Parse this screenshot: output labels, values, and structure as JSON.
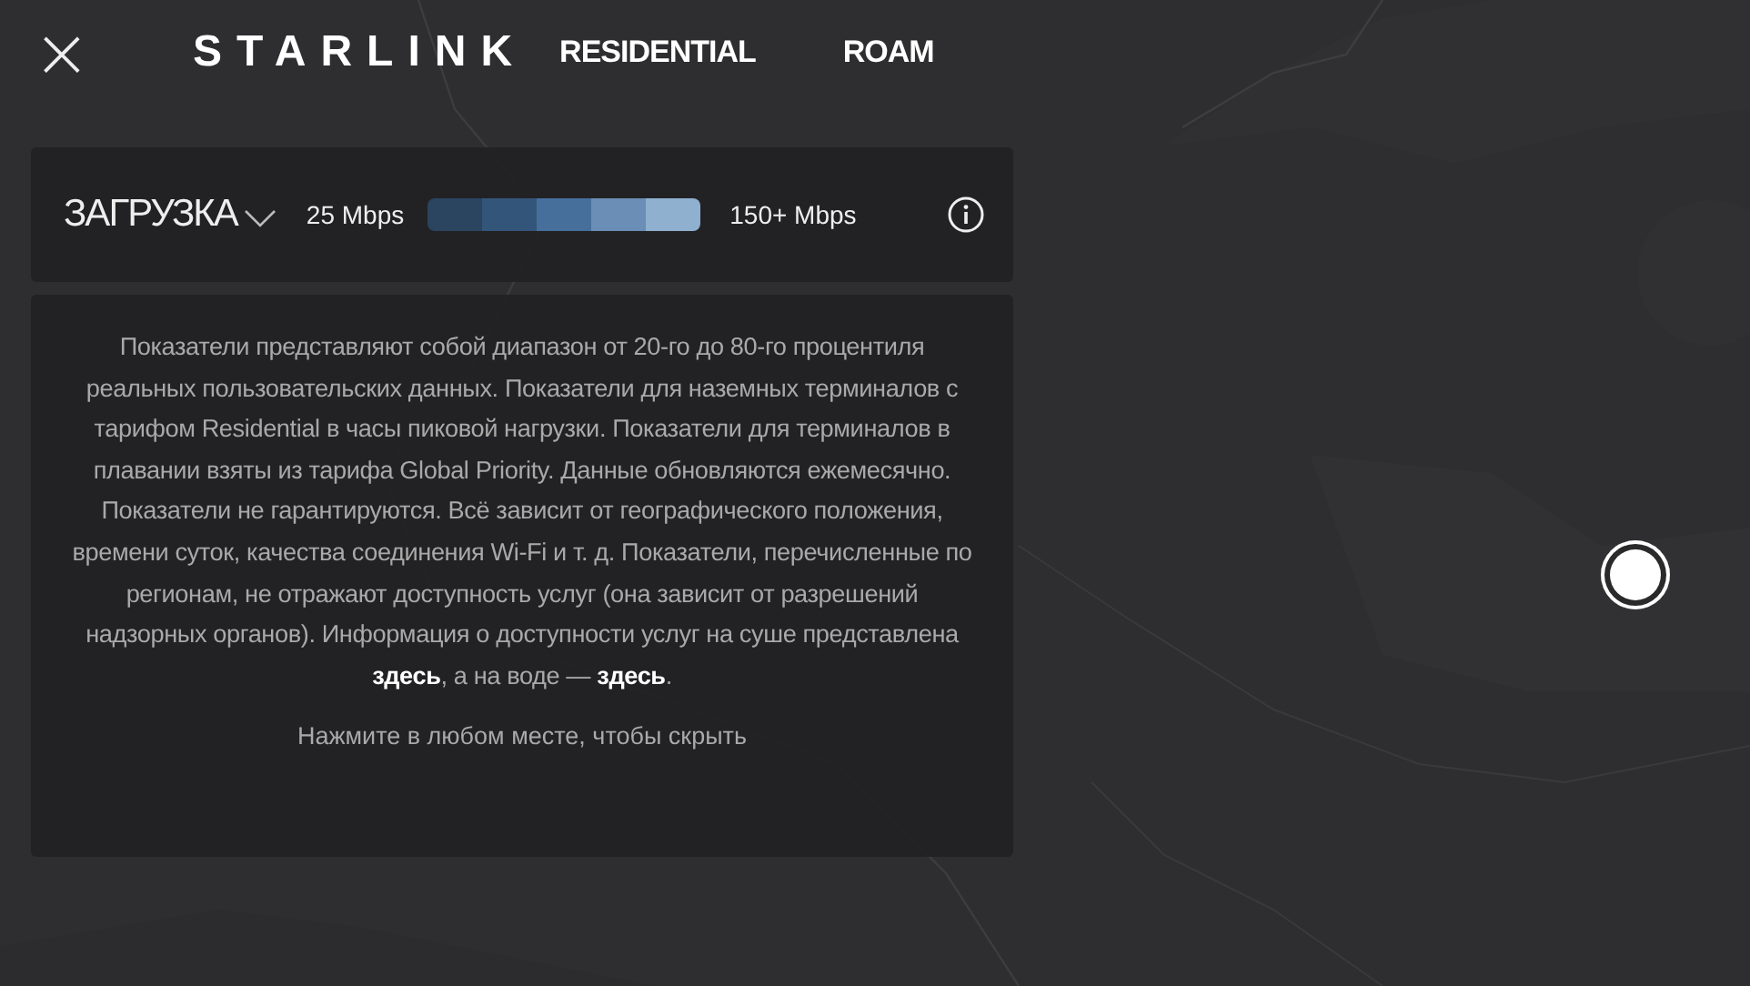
{
  "header": {
    "close": "×",
    "logo": "STARLINK",
    "nav": [
      "RESIDENTIAL",
      "ROAM"
    ]
  },
  "speed_bar": {
    "metric": "ЗАГРУЗКА",
    "min_label": "25 Mbps",
    "max_label": "150+ Mbps",
    "segments": [
      {
        "color": "#2b4460"
      },
      {
        "color": "#34557a"
      },
      {
        "color": "#466f9c"
      },
      {
        "color": "#6a8eb5"
      },
      {
        "color": "#8fb0cf"
      }
    ]
  },
  "info": {
    "text_before": "Показатели представляют собой диапазон от 20-го до 80-го процентиля реальных пользовательских данных. Показатели для наземных терминалов с тарифом Residential в часы пиковой нагрузки. Показатели для терминалов в плавании взяты из тарифа Global Priority. Данные обновляются ежемесячно. Показатели не гарантируются. Всё зависит от географического положения, времени суток, качества соединения Wi-Fi и т. д. Показатели, перечисленные по регионам, не отражают доступность услуг (она зависит от разрешений надзорных органов). Информация о доступности услуг на суше представлена ",
    "link_1": "здесь",
    "text_middle": ", а на воде — ",
    "link_2": "здесь",
    "text_after": ".",
    "hint": "Нажмите в любом месте, чтобы скрыть"
  }
}
